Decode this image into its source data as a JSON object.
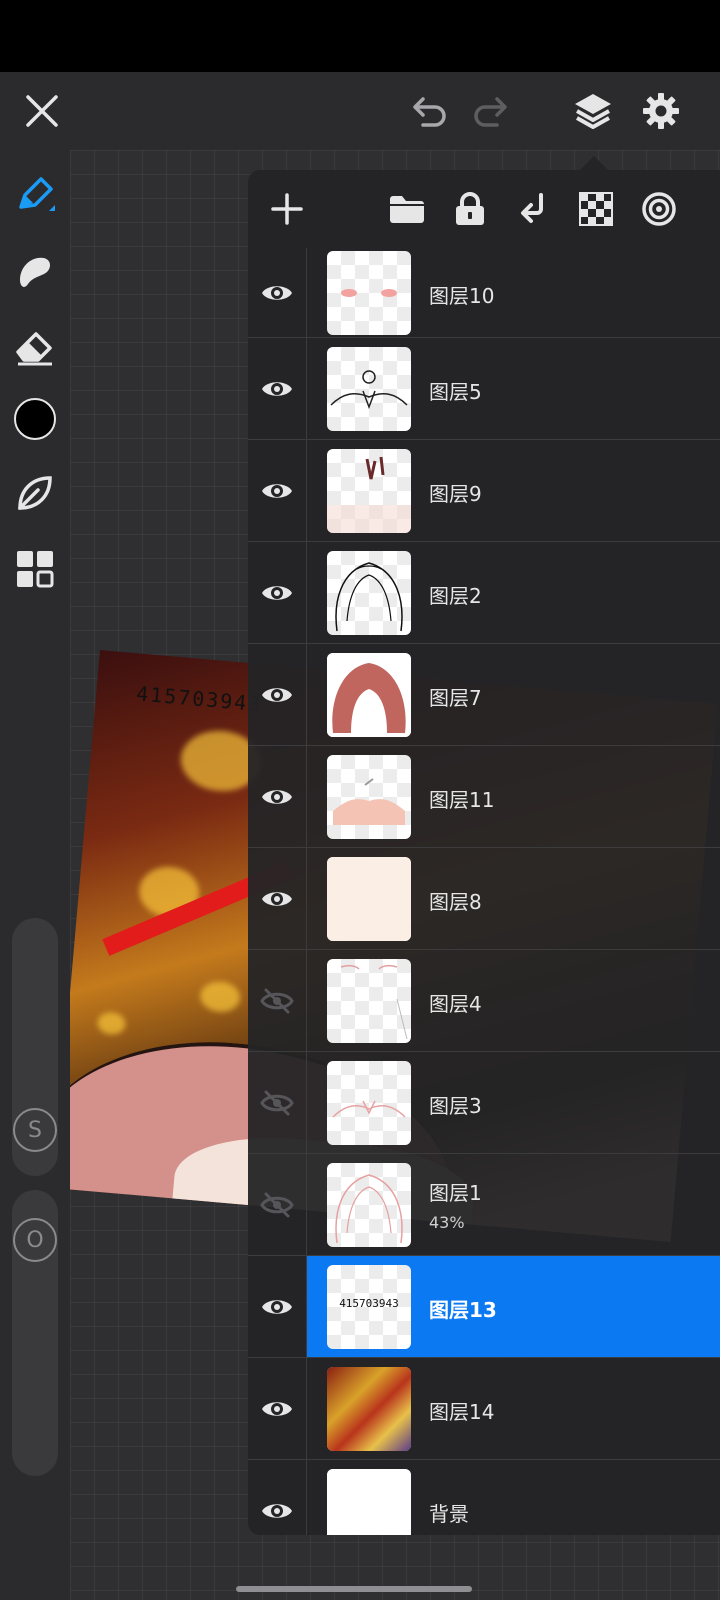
{
  "colors": {
    "accent": "#0a79f2",
    "panel": "#242426",
    "toolbar": "#2b2b2d",
    "icon": "#e6e6e6",
    "hidden_icon": "#5a5a5e"
  },
  "topbar": {
    "icons": [
      "close-icon",
      "undo-icon",
      "redo-icon",
      "layers-icon",
      "settings-icon"
    ]
  },
  "tools": {
    "icons": [
      "brush-icon",
      "smudge-icon",
      "eraser-icon",
      "color-swatch",
      "transform-leaf-icon",
      "grid-menu-icon"
    ],
    "size_slider_label": "S",
    "opacity_slider_label": "O"
  },
  "artwork": {
    "signature": "415703943"
  },
  "layers_panel": {
    "header_icons": [
      "add-layer-icon",
      "folder-icon",
      "lock-icon",
      "merge-down-icon",
      "alpha-lock-icon",
      "blend-mode-icon"
    ],
    "layers": [
      {
        "name": "图层10",
        "visible": true
      },
      {
        "name": "图层5",
        "visible": true
      },
      {
        "name": "图层9",
        "visible": true
      },
      {
        "name": "图层2",
        "visible": true
      },
      {
        "name": "图层7",
        "visible": true
      },
      {
        "name": "图层11",
        "visible": true
      },
      {
        "name": "图层8",
        "visible": true
      },
      {
        "name": "图层4",
        "visible": false
      },
      {
        "name": "图层3",
        "visible": false
      },
      {
        "name": "图层1",
        "visible": false,
        "opacity": "43%"
      },
      {
        "name": "图层13",
        "visible": true,
        "selected": true,
        "thumb_text": "415703943"
      },
      {
        "name": "图层14",
        "visible": true
      },
      {
        "name": "背景",
        "visible": true
      }
    ]
  }
}
